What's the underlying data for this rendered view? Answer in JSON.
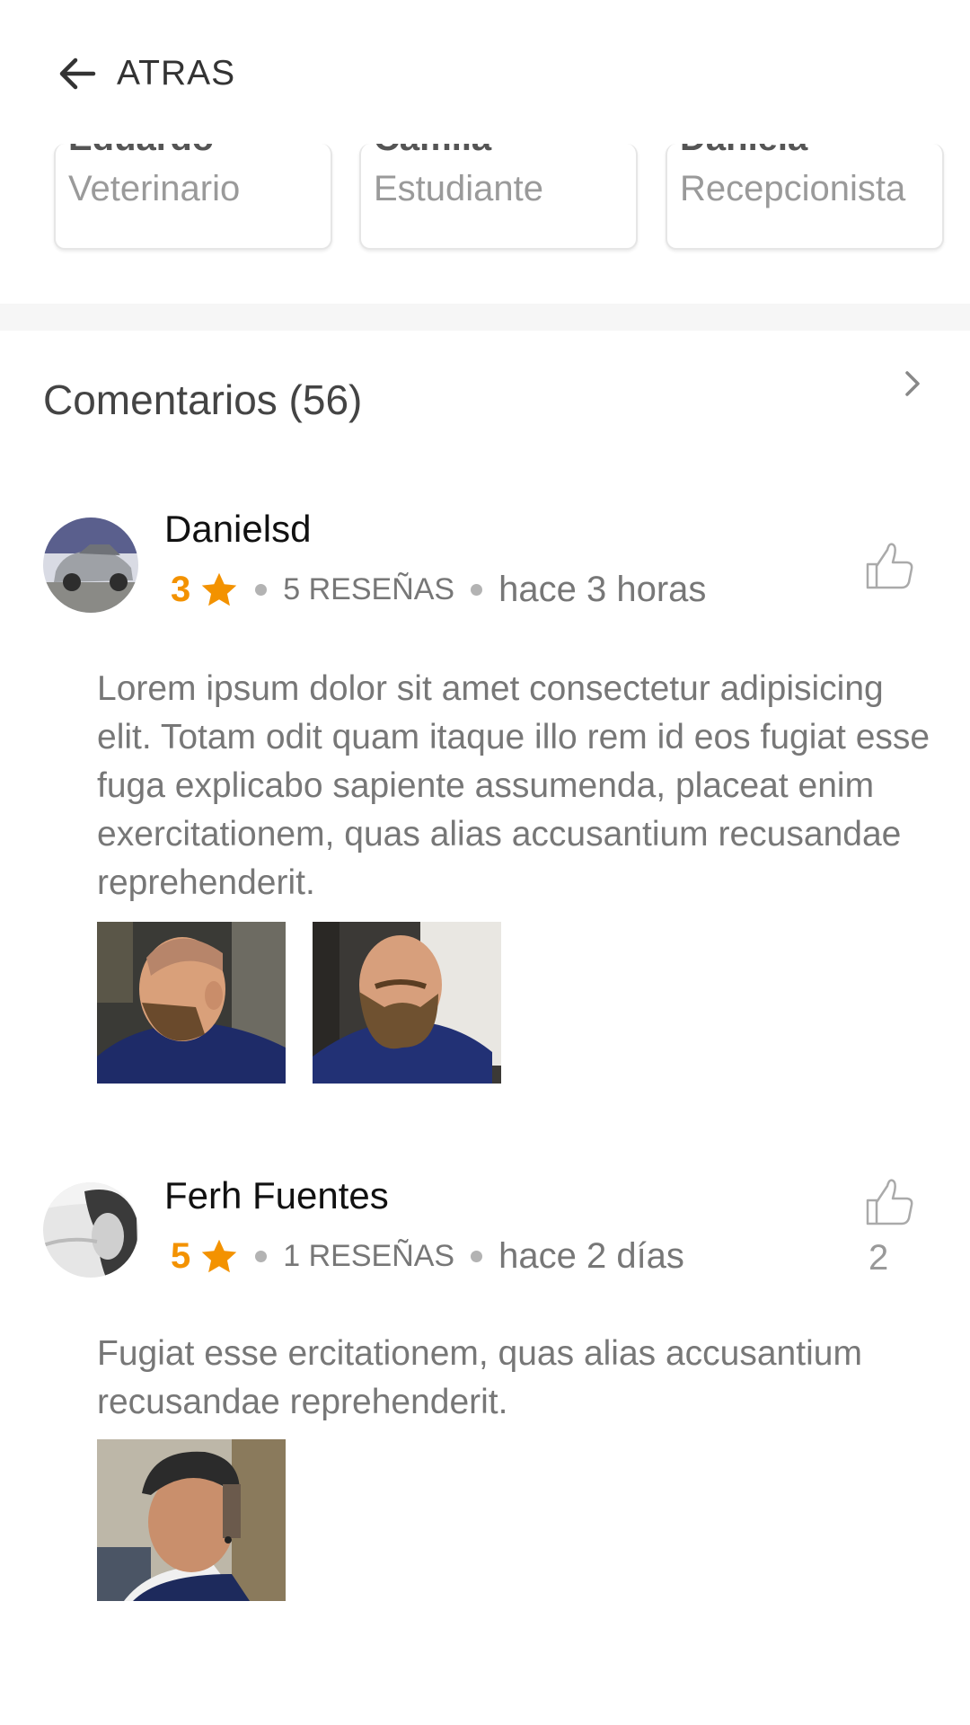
{
  "header": {
    "back_label": "ATRAS"
  },
  "staff": [
    {
      "name": "Eduardo",
      "role": "Veterinario"
    },
    {
      "name": "Camila",
      "role": "Estudiante"
    },
    {
      "name": "Daniela",
      "role": "Recepcionista"
    }
  ],
  "comments": {
    "title": "Comentarios (56)",
    "items": [
      {
        "user": "Danielsd",
        "rating": "3",
        "reviews": "5 RESEÑAS",
        "time": "hace 3 horas",
        "likes": "",
        "text": "Lorem ipsum dolor sit amet consectetur adipisicing elit. Totam odit quam itaque illo rem id eos fugiat esse fuga explicabo sapiente assumenda, placeat enim exercitationem, quas alias accusantium recusandae reprehenderit.",
        "photos": [
          "barber-photo-beard-side",
          "barber-photo-beard-front"
        ]
      },
      {
        "user": "Ferh Fuentes",
        "rating": "5",
        "reviews": "1 RESEÑAS",
        "time": "hace 2 días",
        "likes": "2",
        "text": "Fugiat esse ercitationem, quas alias accusantium recusandae reprehenderit.",
        "photos": [
          "barber-photo-fade-haircut"
        ]
      }
    ]
  },
  "colors": {
    "accent": "#f39200",
    "text_muted": "#777777"
  }
}
